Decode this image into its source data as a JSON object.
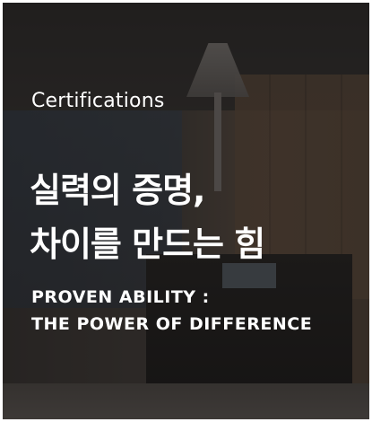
{
  "card": {
    "eyebrow": "Certifications",
    "title_line1": "실력의 증명,",
    "title_line2": "차이를 만드는 힘",
    "subtitle_line1": "PROVEN ABILITY :",
    "subtitle_line2": "THE POWER OF DIFFERENCE",
    "background_image": "laboratory-equipment-photo",
    "text_color": "#ffffff"
  }
}
